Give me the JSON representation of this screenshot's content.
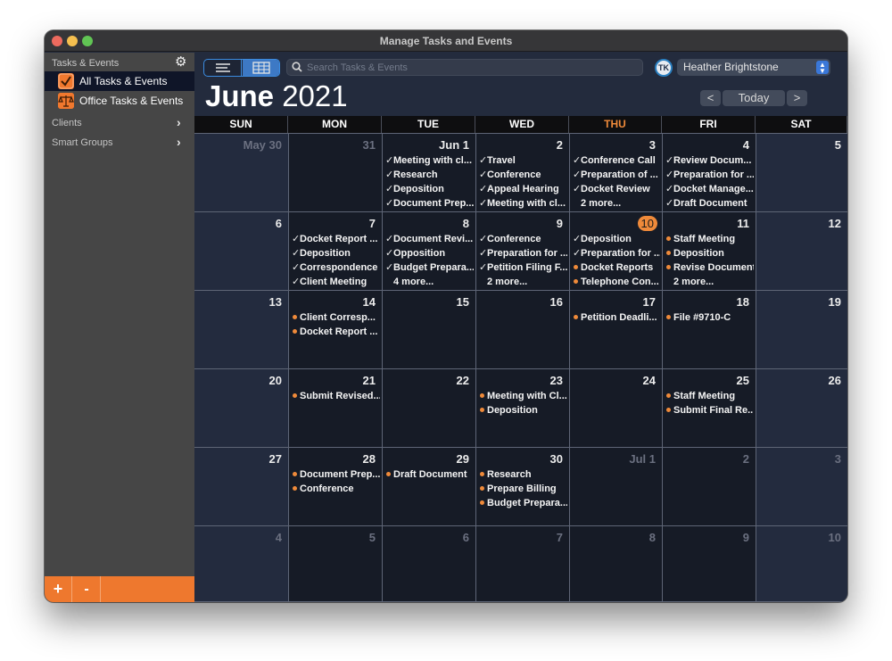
{
  "window": {
    "title": "Manage Tasks and Events"
  },
  "sidebar": {
    "header": "Tasks & Events",
    "items": [
      {
        "label": "All Tasks & Events",
        "icon": "checkbox-icon",
        "active": true
      },
      {
        "label": "Office Tasks & Events",
        "icon": "scales-icon",
        "active": false
      }
    ],
    "groups": [
      {
        "label": "Clients"
      },
      {
        "label": "Smart Groups"
      }
    ],
    "add_label": "+",
    "remove_label": "-"
  },
  "toolbar": {
    "search_placeholder": "Search Tasks & Events",
    "search_value": "",
    "avatar_initials": "TK",
    "user": "Heather Brightstone",
    "prev_label": "<",
    "today_label": "Today",
    "next_label": ">"
  },
  "calendar": {
    "month": "June",
    "year": "2021",
    "accent": "#ef8a3a",
    "days_of_week": [
      "SUN",
      "MON",
      "TUE",
      "WED",
      "THU",
      "FRI",
      "SAT"
    ],
    "today_dow_index": 4,
    "weeks": [
      [
        {
          "label": "May 30",
          "other": true,
          "events": []
        },
        {
          "label": "31",
          "other": true,
          "events": []
        },
        {
          "label": "Jun 1",
          "events": [
            {
              "t": "Meeting with cl...",
              "done": true
            },
            {
              "t": "Research",
              "done": true
            },
            {
              "t": "Deposition",
              "done": true
            },
            {
              "t": "Document Prep...",
              "done": true
            }
          ]
        },
        {
          "label": "2",
          "events": [
            {
              "t": "Travel",
              "done": true
            },
            {
              "t": "Conference",
              "done": true
            },
            {
              "t": "Appeal Hearing",
              "done": true
            },
            {
              "t": "Meeting with cl...",
              "done": true
            }
          ]
        },
        {
          "label": "3",
          "events": [
            {
              "t": "Conference Call",
              "done": true
            },
            {
              "t": "Preparation of ...",
              "done": true
            },
            {
              "t": "Docket Review",
              "done": true
            }
          ],
          "more": "2 more..."
        },
        {
          "label": "4",
          "events": [
            {
              "t": "Review Docum...",
              "done": true
            },
            {
              "t": "Preparation for ...",
              "done": true
            },
            {
              "t": "Docket Manage...",
              "done": true
            },
            {
              "t": "Draft Document",
              "done": true
            }
          ]
        },
        {
          "label": "5",
          "events": []
        }
      ],
      [
        {
          "label": "6",
          "events": []
        },
        {
          "label": "7",
          "events": [
            {
              "t": "Docket Report ...",
              "done": true
            },
            {
              "t": "Deposition",
              "done": true
            },
            {
              "t": "Correspondence",
              "done": true
            },
            {
              "t": "Client Meeting",
              "done": true
            }
          ]
        },
        {
          "label": "8",
          "events": [
            {
              "t": "Document Revi...",
              "done": true
            },
            {
              "t": "Opposition",
              "done": true
            },
            {
              "t": "Budget Prepara...",
              "done": true
            }
          ],
          "more": "4 more..."
        },
        {
          "label": "9",
          "events": [
            {
              "t": "Conference",
              "done": true
            },
            {
              "t": "Preparation for ...",
              "done": true
            },
            {
              "t": "Petition Filing F...",
              "done": true
            }
          ],
          "more": "2 more..."
        },
        {
          "label": "10",
          "today": true,
          "events": [
            {
              "t": "Deposition",
              "done": true
            },
            {
              "t": "Preparation for ...",
              "done": true
            },
            {
              "t": "Docket Reports",
              "done": false
            },
            {
              "t": "Telephone Con...",
              "done": false
            }
          ]
        },
        {
          "label": "11",
          "events": [
            {
              "t": "Staff Meeting",
              "done": false
            },
            {
              "t": "Deposition",
              "done": false
            },
            {
              "t": "Revise Document",
              "done": false
            }
          ],
          "more": "2 more..."
        },
        {
          "label": "12",
          "events": []
        }
      ],
      [
        {
          "label": "13",
          "events": []
        },
        {
          "label": "14",
          "events": [
            {
              "t": "Client Corresp...",
              "done": false
            },
            {
              "t": "Docket Report ...",
              "done": false
            }
          ]
        },
        {
          "label": "15",
          "events": []
        },
        {
          "label": "16",
          "events": []
        },
        {
          "label": "17",
          "events": [
            {
              "t": "Petition Deadli...",
              "done": false
            }
          ]
        },
        {
          "label": "18",
          "events": [
            {
              "t": "File #9710-C",
              "done": false
            }
          ]
        },
        {
          "label": "19",
          "events": []
        }
      ],
      [
        {
          "label": "20",
          "events": []
        },
        {
          "label": "21",
          "events": [
            {
              "t": "Submit Revised...",
              "done": false
            }
          ]
        },
        {
          "label": "22",
          "events": []
        },
        {
          "label": "23",
          "events": [
            {
              "t": "Meeting with Cl...",
              "done": false
            },
            {
              "t": "Deposition",
              "done": false
            }
          ]
        },
        {
          "label": "24",
          "events": []
        },
        {
          "label": "25",
          "events": [
            {
              "t": "Staff Meeting",
              "done": false
            },
            {
              "t": "Submit Final Re...",
              "done": false
            }
          ]
        },
        {
          "label": "26",
          "events": []
        }
      ],
      [
        {
          "label": "27",
          "events": []
        },
        {
          "label": "28",
          "events": [
            {
              "t": "Document Prep...",
              "done": false
            },
            {
              "t": "Conference",
              "done": false
            }
          ]
        },
        {
          "label": "29",
          "events": [
            {
              "t": "Draft Document",
              "done": false
            }
          ]
        },
        {
          "label": "30",
          "events": [
            {
              "t": "Research",
              "done": false
            },
            {
              "t": "Prepare Billing",
              "done": false
            },
            {
              "t": "Budget Prepara...",
              "done": false
            }
          ]
        },
        {
          "label": "Jul 1",
          "other": true,
          "events": []
        },
        {
          "label": "2",
          "other": true,
          "events": []
        },
        {
          "label": "3",
          "other": true,
          "events": []
        }
      ],
      [
        {
          "label": "4",
          "other": true,
          "events": []
        },
        {
          "label": "5",
          "other": true,
          "events": []
        },
        {
          "label": "6",
          "other": true,
          "events": []
        },
        {
          "label": "7",
          "other": true,
          "events": []
        },
        {
          "label": "8",
          "other": true,
          "events": []
        },
        {
          "label": "9",
          "other": true,
          "events": []
        },
        {
          "label": "10",
          "other": true,
          "events": []
        }
      ]
    ]
  }
}
